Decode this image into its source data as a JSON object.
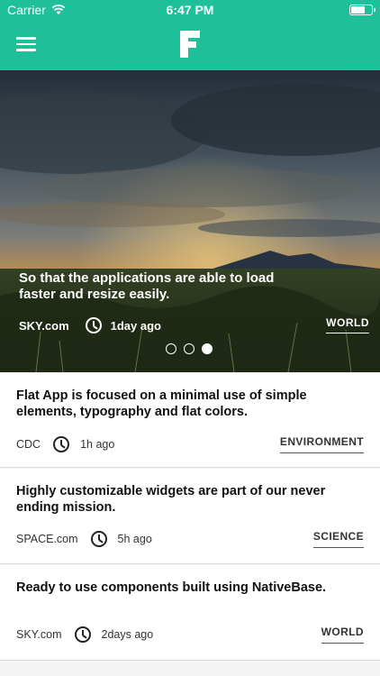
{
  "status_bar": {
    "carrier": "Carrier",
    "time": "6:47 PM",
    "battery_level": 0.7
  },
  "nav": {
    "menu_icon": "hamburger-menu-icon",
    "logo_letter": "F",
    "background_color": "#1fbf9a"
  },
  "hero": {
    "slides_count": 3,
    "active_slide": 3,
    "caption": "So that the applications are able to load faster and resize easily.",
    "source": "SKY.com",
    "time": "1day ago",
    "category": "WORLD"
  },
  "articles": [
    {
      "title": "Flat App is focused on a minimal use of simple elements, typography and flat colors.",
      "source": "CDC",
      "time": "1h ago",
      "category": "ENVIRONMENT"
    },
    {
      "title": "Highly customizable widgets are part of our never ending mission.",
      "source": "SPACE.com",
      "time": "5h ago",
      "category": "SCIENCE"
    },
    {
      "title": "Ready to use components built using NativeBase.",
      "source": "SKY.com",
      "time": "2days ago",
      "category": "WORLD"
    }
  ]
}
